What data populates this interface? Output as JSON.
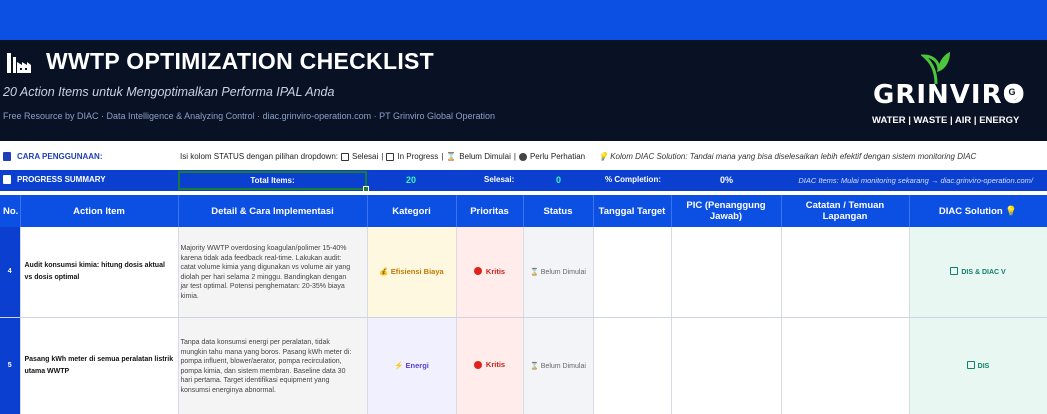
{
  "header": {
    "title": "WWTP OPTIMIZATION CHECKLIST",
    "subtitle": "20 Action Items untuk Mengoptimalkan Performa IPAL Anda",
    "credits": "Free Resource by DIAC  ·  Data Intelligence & Analyzing Control  ·  diac.grinviro-operation.com  ·  PT Grinviro Global Operation",
    "logo_word": "GRINVIRO",
    "logo_badge": "G",
    "logo_tagline": "WATER | WASTE | AIR | ENERGY"
  },
  "usage": {
    "label": "CARA PENGGUNAAN:",
    "instruction_prefix": "Isi kolom STATUS dengan pilihan dropdown:",
    "opt_selesai": "Selesai",
    "opt_inprogress": "In Progress",
    "opt_belum": "Belum Dimulai",
    "opt_perlu": "Perlu Perhatian",
    "note": "Kolom DIAC Solution: Tandai mana yang bisa diselesaikan lebih efektif dengan sistem monitoring DIAC"
  },
  "progress": {
    "label": "PROGRESS SUMMARY",
    "total_label": "Total Items:",
    "total_value": "20",
    "selesai_label": "Selesai:",
    "selesai_value": "0",
    "completion_label": "% Completion:",
    "completion_value": "0%",
    "right_note": "DIAC Items: Mulai monitoring sekarang → diac.grinviro-operation.com/"
  },
  "table": {
    "columns": [
      "No.",
      "Action Item",
      "Detail & Cara Implementasi",
      "Kategori",
      "Prioritas",
      "Status",
      "Tanggal Target",
      "PIC (Penanggung Jawab)",
      "Catatan / Temuan Lapangan",
      "DIAC Solution"
    ],
    "rows": [
      {
        "no": "4",
        "action": "Audit konsumsi kimia: hitung dosis aktual vs dosis optimal",
        "detail": "Majority WWTP overdosing koagulan/polimer 15-40% karena tidak ada feedback real-time. Lakukan audit: catat volume kimia yang digunakan vs volume air yang diolah per hari selama 2 minggu. Bandingkan dengan jar test optimal. Potensi penghematan: 20-35% biaya kimia.",
        "kategori": "Efisiensi Biaya",
        "prioritas": "Kritis",
        "status": "Belum Dimulai",
        "tanggal": "",
        "pic": "",
        "catatan": "",
        "diac": "DIS & DIAC V"
      },
      {
        "no": "5",
        "action": "Pasang kWh meter di semua peralatan listrik utama WWTP",
        "detail": "Tanpa data konsumsi energi per peralatan, tidak mungkin tahu mana yang boros. Pasang kWh meter di: pompa influent, blower/aerator, pompa recirculation, pompa kimia, dan sistem membran. Baseline data 30 hari pertama. Target identifikasi equipment yang konsumsi energinya abnormal.",
        "kategori": "Energi",
        "prioritas": "Kritis",
        "status": "Belum Dimulai",
        "tanggal": "",
        "pic": "",
        "catatan": "",
        "diac": "DIS"
      }
    ]
  },
  "colors": {
    "topbar": "#0b50e3",
    "header_bg": "#081224",
    "progress_bg": "#0b3fcf",
    "accent_green": "#3ef5c0",
    "priority_red": "#e0241b",
    "diac_teal": "#12806b"
  },
  "icons": {
    "factory": "factory-icon",
    "leaf": "leaf-icon",
    "usage": "clipboard-icon",
    "progress": "chart-icon",
    "bulb": "lightbulb-icon",
    "hourglass": "hourglass-icon",
    "bolt": "lightning-icon"
  }
}
